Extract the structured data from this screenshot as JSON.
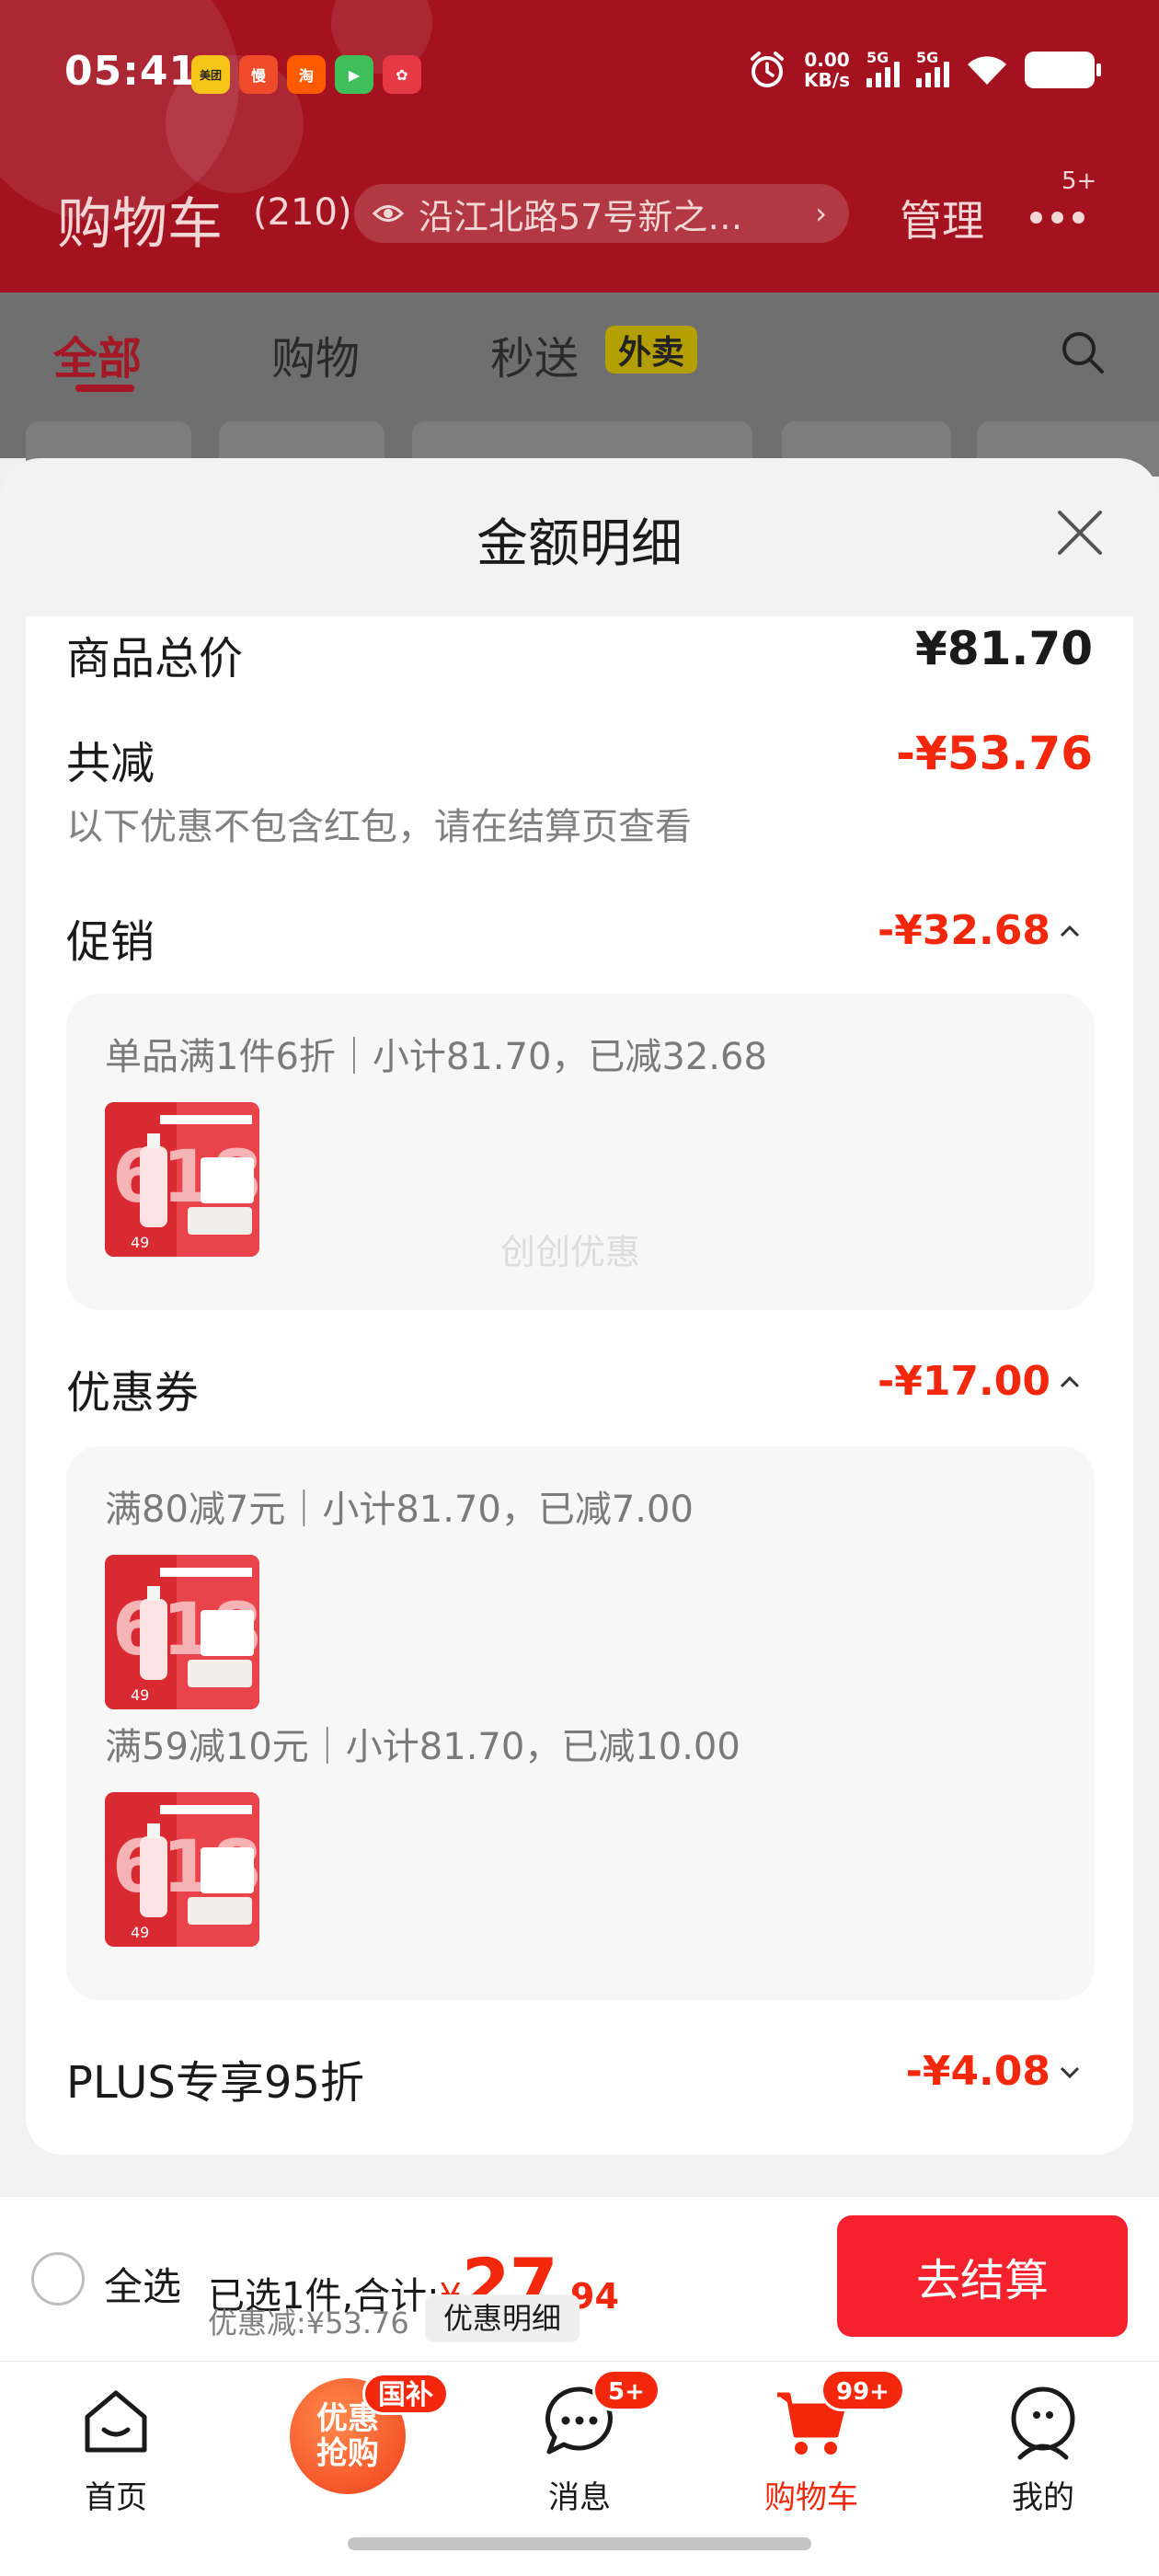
{
  "status_bar": {
    "time": "05:41",
    "app_icons": [
      {
        "name": "meituan",
        "label": "美团",
        "color": "#f5c518"
      },
      {
        "name": "app-2",
        "label": "慢",
        "color": "#ef4b2a"
      },
      {
        "name": "taobao",
        "label": "淘",
        "color": "#ff5a00"
      },
      {
        "name": "app-4",
        "label": "▶",
        "color": "#3fbf5a"
      },
      {
        "name": "app-5",
        "label": "✿",
        "color": "#e63946"
      }
    ],
    "net_speed_value": "0.00",
    "net_speed_unit": "KB/s",
    "signal_1": "5G",
    "signal_2": "5G"
  },
  "header": {
    "title": "购物车",
    "count": "(210)",
    "address": "沿江北路57号新之…",
    "manage": "管理",
    "more_badge": "5+"
  },
  "tabs": [
    {
      "label": "全部",
      "active": true
    },
    {
      "label": "购物",
      "active": false
    },
    {
      "label": "秒送",
      "active": false
    }
  ],
  "waimai_badge": "外卖",
  "modal": {
    "title": "金额明细",
    "total_label": "商品总价",
    "total_value": "¥81.70",
    "reduce_label": "共减",
    "reduce_value": "-¥53.76",
    "reduce_note": "以下优惠不包含红包，请在结算页查看",
    "promo_label": "促销",
    "promo_value": "-¥32.68",
    "promo_items": [
      {
        "text": "单品满1件6折｜小计81.70，已减32.68",
        "thumb_price": "49"
      }
    ],
    "watermark": "创创优惠",
    "coupon_label": "优惠券",
    "coupon_value": "-¥17.00",
    "coupon_items": [
      {
        "text": "满80减7元｜小计81.70，已减7.00",
        "thumb_price": "49"
      },
      {
        "text": "满59减10元｜小计81.70，已减10.00",
        "thumb_price": "49"
      }
    ],
    "plus_label": "PLUS专享95折",
    "plus_value": "-¥4.08"
  },
  "checkout": {
    "select_all": "全选",
    "selected_text": "已选1件,合计:",
    "currency": "¥",
    "amount_int": "27",
    "amount_dec": ".94",
    "discount_text": "优惠减:¥53.76",
    "detail_button": "优惠明细",
    "checkout_button": "去结算"
  },
  "tabbar": {
    "home": "首页",
    "promo_line1": "优惠",
    "promo_line2": "抢购",
    "promo_badge": "国补",
    "messages": "消息",
    "messages_badge": "5+",
    "cart": "购物车",
    "cart_badge": "99+",
    "me": "我的"
  },
  "colors": {
    "accent_red": "#f2270c",
    "header_red": "#a41220",
    "checkout_red": "#f5222d"
  }
}
